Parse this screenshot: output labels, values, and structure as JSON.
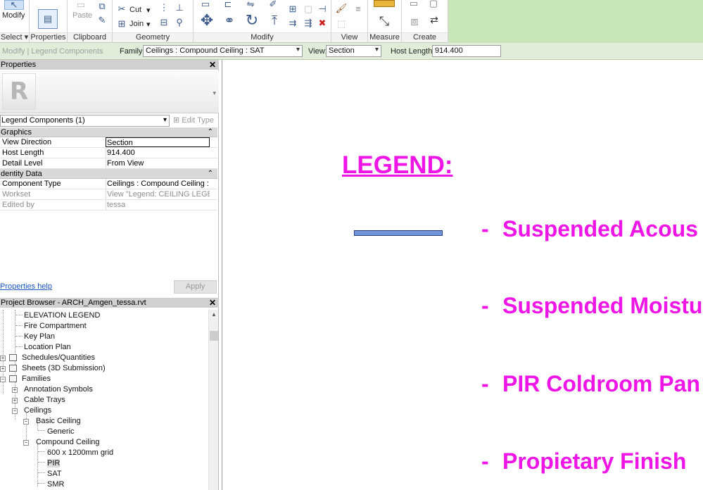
{
  "ribbon": {
    "modify_label": "Modify",
    "select_label": "Select",
    "properties_label": "Properties",
    "paste_label": "Paste",
    "cut_label": "Cut",
    "join_label": "Join",
    "panels": {
      "clipboard": "Clipboard",
      "geometry": "Geometry",
      "modify": "Modify",
      "view": "View",
      "measure": "Measure",
      "create": "Create"
    }
  },
  "options_bar": {
    "context": "Modify | Legend Components",
    "family_label": "Family:",
    "family_value": "Ceilings : Compound Ceiling : SAT",
    "view_label": "View:",
    "view_value": "Section",
    "host_length_label": "Host Length:",
    "host_length_value": "914.400"
  },
  "properties": {
    "title": "Properties",
    "type_selector": "Legend Components (1)",
    "edit_type": "Edit Type",
    "sections": {
      "graphics": "Graphics",
      "identity": "dentity Data"
    },
    "rows": [
      {
        "key": "View Direction",
        "value": "Section"
      },
      {
        "key": "Host Length",
        "value": "914.400"
      },
      {
        "key": "Detail Level",
        "value": "From View"
      },
      {
        "key": "Component Type",
        "value": "Ceilings : Compound Ceiling : S..."
      },
      {
        "key": "Workset",
        "value": "View \"Legend: CEILING LEGEND\""
      },
      {
        "key": "Edited by",
        "value": "tessa"
      }
    ],
    "help_link": "Properties help",
    "apply": "Apply"
  },
  "browser": {
    "title": "Project Browser - ARCH_Amgen_tessa.rvt",
    "items": [
      "ELEVATION LEGEND",
      "Fire Compartment",
      "Key Plan",
      "Location Plan",
      "Schedules/Quantities",
      "Sheets (3D Submission)",
      "Families",
      "Annotation Symbols",
      "Cable Trays",
      "Ceilings",
      "Basic Ceiling",
      "Generic",
      "Compound Ceiling",
      "600 x 1200mm grid",
      "PIR",
      "SAT",
      "SMR"
    ]
  },
  "canvas": {
    "legend_title": "LEGEND:",
    "rows": [
      "Suspended Acous",
      "Suspended Moistu",
      "PIR Coldroom Pan",
      "Propietary Finish"
    ],
    "dash": "-",
    "colors": {
      "legend_text": "#ee15e6",
      "swatch": "#6f94d8"
    }
  }
}
